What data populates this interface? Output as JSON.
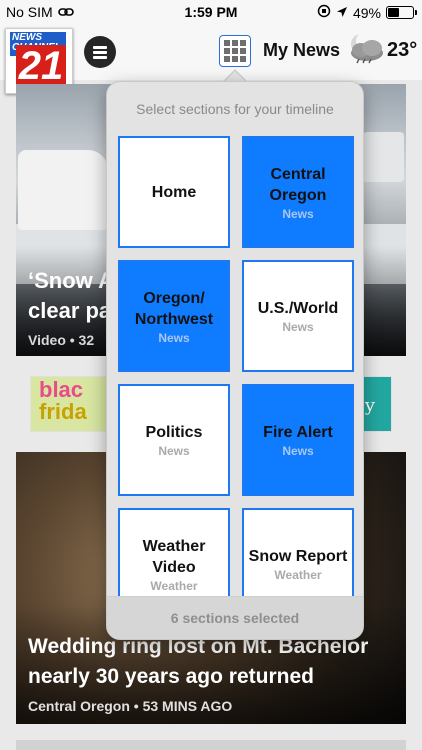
{
  "status_bar": {
    "carrier": "No SIM",
    "time": "1:59 PM",
    "battery": "49%",
    "battery_level": 0.49
  },
  "header": {
    "logo_text": "NEWS CHANNEL",
    "logo_number": "21",
    "my_news_label": "My News",
    "temperature": "23°",
    "icons": [
      "menu-icon",
      "grid-icon",
      "partly-cloudy-night-icon"
    ]
  },
  "feed": {
    "story1": {
      "title_line1": "‘Snow A",
      "title_line2": "clear pa",
      "meta": "Video • 32"
    },
    "ad": {
      "left_text_1": "blac",
      "left_text_2": "frida",
      "right_text": "ey"
    },
    "story2": {
      "title_line1": "Wedding ring lost on Mt. Bachelor",
      "title_line2": "nearly 30 years ago returned",
      "meta": "Central Oregon • 53 MINS AGO"
    }
  },
  "popover": {
    "title": "Select sections for your timeline",
    "sections": [
      {
        "name": "Home",
        "sub": "",
        "selected": false
      },
      {
        "name": "Central Oregon",
        "sub": "News",
        "selected": true
      },
      {
        "name": "Oregon/ Northwest",
        "sub": "News",
        "selected": true
      },
      {
        "name": "U.S./World",
        "sub": "News",
        "selected": false
      },
      {
        "name": "Politics",
        "sub": "News",
        "selected": false
      },
      {
        "name": "Fire Alert",
        "sub": "News",
        "selected": true
      },
      {
        "name": "Weather Video",
        "sub": "Weather",
        "selected": false
      },
      {
        "name": "Snow Report",
        "sub": "Weather",
        "selected": false
      }
    ],
    "footer": "6 sections selected"
  },
  "colors": {
    "accent_blue": "#0f7bff",
    "tile_border": "#1e78f2",
    "logo_red": "#d8201b",
    "logo_blue": "#1f5ec8"
  }
}
